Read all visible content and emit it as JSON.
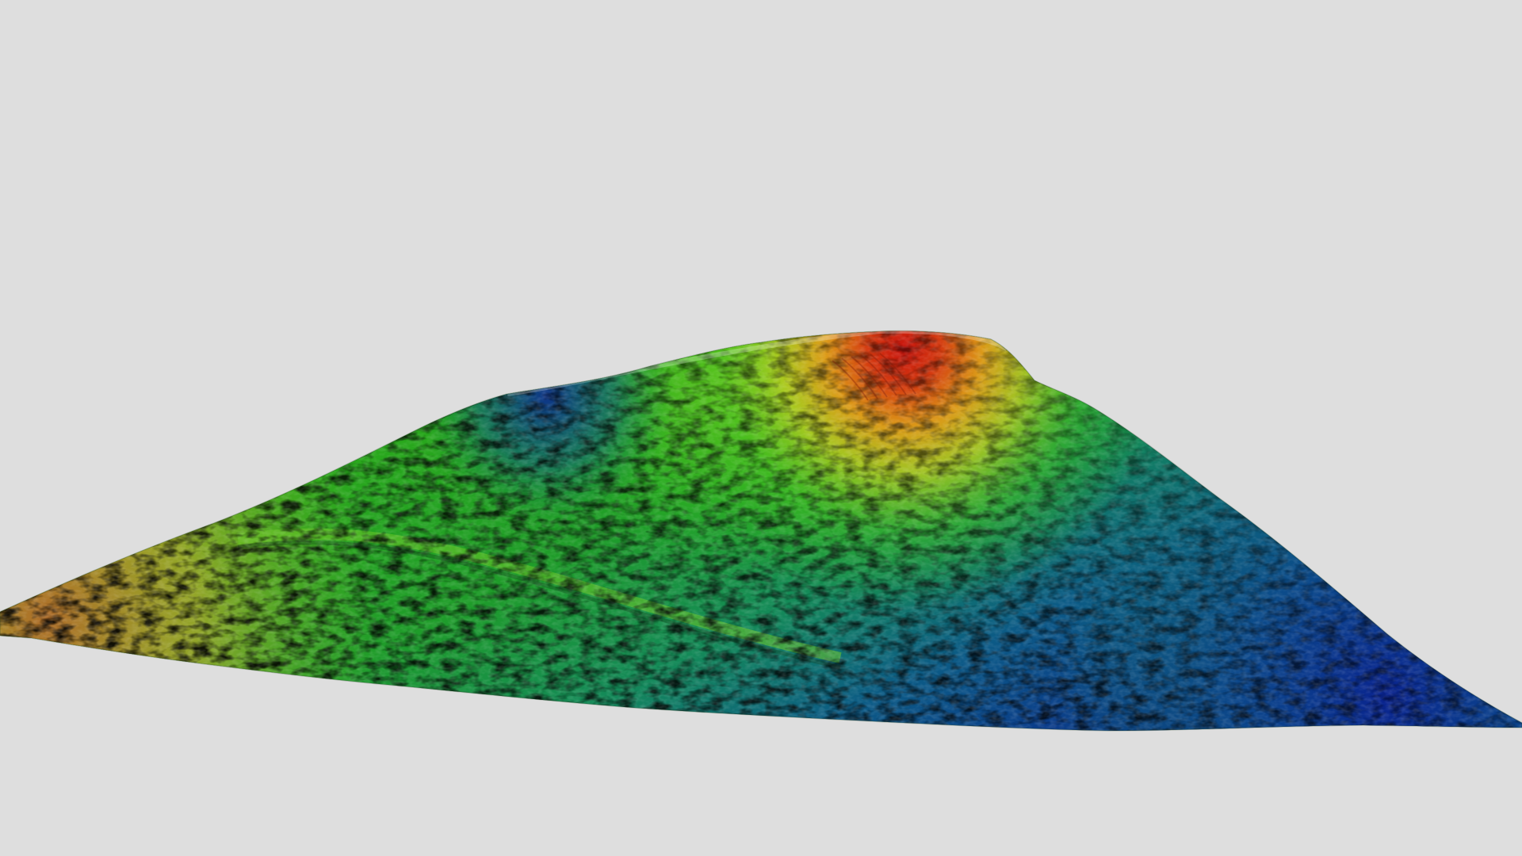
{
  "scene": {
    "background_color": "#dedede",
    "colormap": {
      "low": "#0b2a8a",
      "low_mid": "#138a5a",
      "mid": "#22b81a",
      "mid_high": "#b7c81f",
      "high_orange": "#e48a16",
      "peak": "#c8170f",
      "edge_tan": "#b07a2a"
    }
  }
}
